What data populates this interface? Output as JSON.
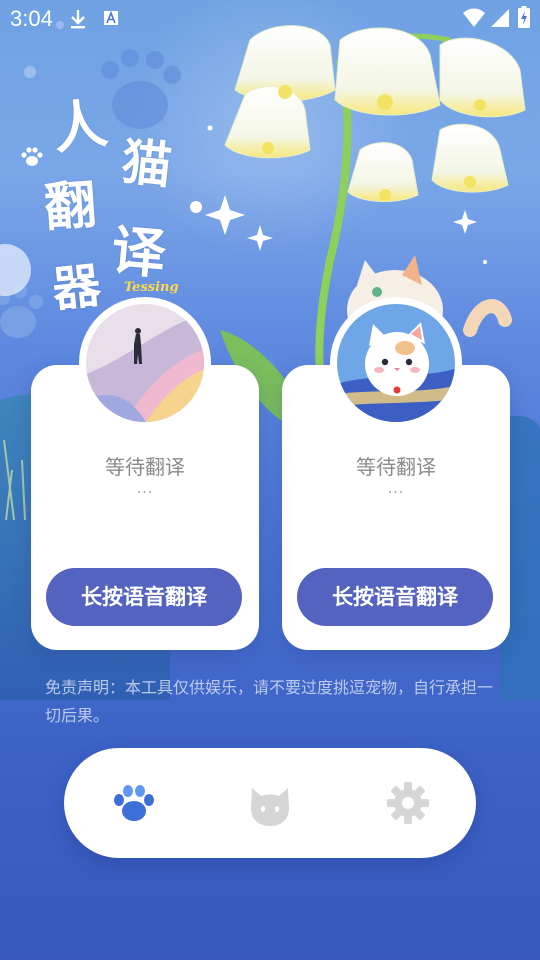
{
  "status_bar": {
    "time": "3:04",
    "left_icons": [
      "download-icon",
      "a-badge-icon"
    ],
    "right_icons": [
      "wifi-icon",
      "signal-icon",
      "battery-icon"
    ]
  },
  "header": {
    "title_chars": [
      "人",
      "猫",
      "翻",
      "译",
      "器"
    ],
    "brand": "Tessing"
  },
  "cards": [
    {
      "id": "human",
      "status": "等待翻译",
      "dots": "...",
      "button_label": "长按语音翻译",
      "avatar": "person-avatar"
    },
    {
      "id": "cat",
      "status": "等待翻译",
      "dots": "...",
      "button_label": "长按语音翻译",
      "avatar": "cat-avatar"
    }
  ],
  "disclaimer": "免责声明：本工具仅供娱乐，请不要过度挑逗宠物，自行承担一切后果。",
  "bottom_nav": {
    "items": [
      {
        "icon": "paw-icon",
        "active": true
      },
      {
        "icon": "cat-face-icon",
        "active": false
      },
      {
        "icon": "gear-icon",
        "active": false
      }
    ]
  },
  "colors": {
    "accent": "#5462c0",
    "nav_active": "#3d6fd8",
    "nav_inactive": "#d6d6d6",
    "brand_yellow": "#ffd84a"
  }
}
